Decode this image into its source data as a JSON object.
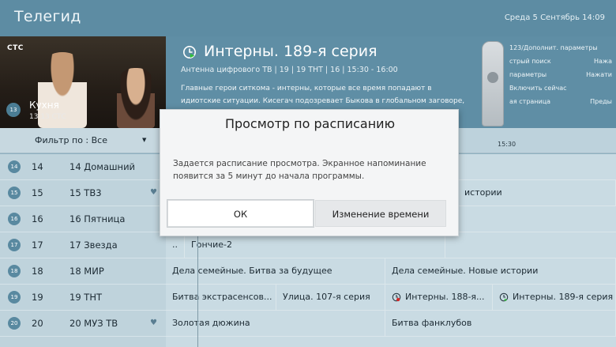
{
  "header": {
    "app_title": "Телегид",
    "datetime": "Среда 5 Сентябрь  14:09"
  },
  "preview": {
    "channel_logo": "СТС",
    "show_name": "Кухня",
    "channel_info": "13  13 СТС",
    "channel_badge": "13"
  },
  "info": {
    "icon": "schedule-clock-icon",
    "title": "Интерны. 189-я серия",
    "subtitle": "Антенна цифрового ТВ  |  19  |  19 ТНТ  |  16  |  15:30 - 16:00",
    "description": "Главные герои ситкома - интерны, которые все время попадают в идиотские ситуации. Кисегач подозревает Быкова в глобальном заговоре, направленном",
    "remote_hints": [
      {
        "left": "123/Дополнит. параметры",
        "right": ""
      },
      {
        "left": "стрый поиск",
        "right": "Нажа"
      },
      {
        "left": "параметры",
        "right": "Нажати"
      },
      {
        "left": "Включить сейчас",
        "right": ""
      },
      {
        "left": "ая страница",
        "right": "Преды"
      }
    ]
  },
  "filter": {
    "label": "Фильтр по : Все",
    "caret_icon": "dropdown-caret-icon"
  },
  "timeline": {
    "time_label": "15:30"
  },
  "channels": [
    {
      "badge": "14",
      "num": "14",
      "name": "14 Домашний",
      "fav": ""
    },
    {
      "badge": "15",
      "num": "15",
      "name": "15 ТВ3",
      "fav": "♥"
    },
    {
      "badge": "16",
      "num": "16",
      "name": "16 Пятница",
      "fav": ""
    },
    {
      "badge": "17",
      "num": "17",
      "name": "17 Звезда",
      "fav": ""
    },
    {
      "badge": "18",
      "num": "18",
      "name": "18 МИР",
      "fav": ""
    },
    {
      "badge": "19",
      "num": "19",
      "name": "19 ТНТ",
      "fav": ""
    },
    {
      "badge": "20",
      "num": "20",
      "name": "20 МУЗ ТВ",
      "fav": "♥"
    }
  ],
  "programs": {
    "row15_right": "истории",
    "row17_a": "..",
    "row17_b": "Гончие-2",
    "row18_a": "Дела семейные. Битва за будущее",
    "row18_b": "Дела семейные. Новые истории",
    "row19_a": "Битва экстрасенсов...",
    "row19_b": "Улица. 107-я серия",
    "row19_c": "Интерны. 188-я...",
    "row19_d": "Интерны. 189-я серия",
    "row20_a": "Золотая дюжина",
    "row20_b": "Битва фанклубов"
  },
  "dialog": {
    "title": "Просмотр по расписанию",
    "body": "Задается расписание просмотра. Экранное напоминание появится за 5 минут до начала программы.",
    "ok_label": "ОК",
    "change_label": "Изменение времени"
  },
  "colors": {
    "header_bg": "#5d8ca3",
    "dialog_bg": "#f4f5f6",
    "badge": "#5989a0"
  }
}
